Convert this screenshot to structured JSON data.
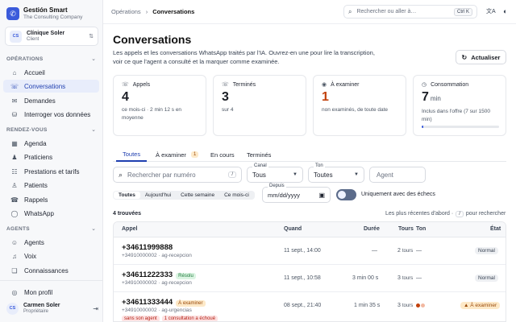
{
  "brand": {
    "logo": "✆",
    "name": "Gestión Smart",
    "sub": "The Consulting Company"
  },
  "client": {
    "initials": "CS",
    "name": "Clínique Soler",
    "role": "Client",
    "switch_icon": "⇅"
  },
  "sections": {
    "operations": "OPÉRATIONS",
    "rendezvous": "RENDEZ-VOUS",
    "agents": "AGENTS"
  },
  "nav": {
    "operations": [
      {
        "icon": "⌂",
        "label": "Accueil"
      },
      {
        "icon": "☏",
        "label": "Conversations"
      },
      {
        "icon": "✉",
        "label": "Demandes"
      },
      {
        "icon": "⛁",
        "label": "Interroger vos données"
      }
    ],
    "rendezvous": [
      {
        "icon": "▦",
        "label": "Agenda"
      },
      {
        "icon": "♟",
        "label": "Praticiens"
      },
      {
        "icon": "☷",
        "label": "Prestations et tarifs"
      },
      {
        "icon": "♙",
        "label": "Patients"
      },
      {
        "icon": "☎",
        "label": "Rappels"
      },
      {
        "icon": "◯",
        "label": "WhatsApp"
      }
    ],
    "agents": [
      {
        "icon": "☺",
        "label": "Agents"
      },
      {
        "icon": "♫",
        "label": "Voix"
      },
      {
        "icon": "❏",
        "label": "Connaissances"
      }
    ]
  },
  "profile": {
    "icon": "◎",
    "label": "Mon profil"
  },
  "user": {
    "initials": "CS",
    "name": "Carmen Soler",
    "role": "Propriétaire",
    "logout_icon": "⇥"
  },
  "topbar": {
    "breadcrumb_parent": "Opérations",
    "breadcrumb_sep": "›",
    "breadcrumb_current": "Conversations",
    "search_placeholder": "Rechercher ou aller à…",
    "search_kbd": "Ctrl K",
    "translate_icon": "文A",
    "theme_icon": "◐"
  },
  "page": {
    "title": "Conversations",
    "description": "Les appels et les conversations WhatsApp traités par l'IA. Ouvrez-en une pour lire la transcription, voir ce que l'agent a consulté et la marquer comme examinée.",
    "refresh_icon": "↻",
    "refresh_label": "Actualiser"
  },
  "cards": [
    {
      "icon": "☏",
      "title": "Appels",
      "value": "4",
      "unit": "",
      "sub": "ce mois-ci · 2 min 12 s en moyenne"
    },
    {
      "icon": "☏",
      "title": "Terminés",
      "value": "3",
      "unit": "",
      "sub": "sur 4"
    },
    {
      "icon": "◉",
      "title": "À examiner",
      "value": "1",
      "unit": "",
      "sub": "non examinés, de toute date"
    },
    {
      "icon": "◷",
      "title": "Consommation",
      "value": "7",
      "unit": "min",
      "sub": "Inclus dans l'offre (7 sur 1500 min)",
      "usage_fraction": 0.0047
    }
  ],
  "tabs": [
    {
      "label": "Toutes"
    },
    {
      "label": "À examiner",
      "badge": "1"
    },
    {
      "label": "En cours"
    },
    {
      "label": "Terminés"
    }
  ],
  "filters": {
    "search_icon": "⌕",
    "search_placeholder": "Rechercher par numéro",
    "search_kbd": "/",
    "canal_label": "Canal",
    "canal_value": "Tous",
    "ton_label": "Ton",
    "ton_value": "Toutes",
    "agent_placeholder": "Agent",
    "depuis_label": "Depuis",
    "depuis_placeholder": "mm/dd/yyyy",
    "calendar_icon": "▣",
    "caret": "▼",
    "periods": [
      "Toutes",
      "Aujourd'hui",
      "Cette semaine",
      "Ce mois-ci"
    ],
    "toggle_label": "Uniquement avec des échecs",
    "toggle_on": true
  },
  "results": {
    "count": "4 trouvées",
    "sort_text": "Les plus récentes d'abord ·",
    "sort_kbd": "/",
    "sort_suffix": "pour rechercher"
  },
  "table": {
    "headers": {
      "appel": "Appel",
      "quand": "Quand",
      "duree": "Durée",
      "tours": "Tours",
      "ton": "Ton",
      "etat": "État"
    },
    "rows": [
      {
        "phone": "+34611999888",
        "tag": "",
        "meta": "+34910000002 · ag-recepcion",
        "when": "11 sept., 14:00",
        "duration": "—",
        "turns": "2",
        "turns_unit": "tours",
        "tone": "—",
        "state": "Normal"
      },
      {
        "phone": "+34611222333",
        "tag": "Résolu",
        "meta": "+34910000002 · ag-recepcion",
        "when": "11 sept., 10:58",
        "duration": "3 min 00 s",
        "turns": "3",
        "turns_unit": "tours",
        "tone": "—",
        "state": "Normal"
      },
      {
        "phone": "+34611333444",
        "tag": "À examiner",
        "meta": "+34910000002 · ag-urgencias",
        "when": "08 sept., 21:40",
        "duration": "1 min 35 s",
        "turns": "3",
        "turns_unit": "tours",
        "tone": "",
        "state": "À examiner",
        "red_tags": [
          "sans son agent",
          "1 consultation a échoué"
        ]
      }
    ]
  },
  "colors": {
    "accent": "#1f3fb0",
    "brand": "#3b5bdb",
    "warn": "#c2410c",
    "ok": "#1f7a3c"
  }
}
